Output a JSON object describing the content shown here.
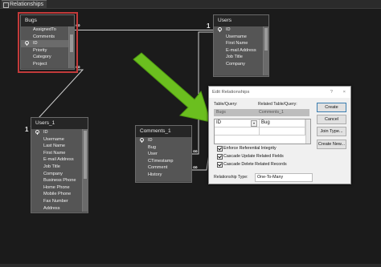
{
  "tab": {
    "title": "Relationships",
    "close": "×"
  },
  "tables": {
    "bugs": {
      "title": "Bugs",
      "rows": [
        "AssignedTo",
        "Comments",
        "ID",
        "Priority",
        "Category",
        "Project"
      ]
    },
    "users": {
      "title": "Users",
      "rows": [
        "ID",
        "Username",
        "First Name",
        "E-mail Address",
        "Job Title",
        "Company"
      ]
    },
    "users_1": {
      "title": "Users_1",
      "rows": [
        "ID",
        "Username",
        "Last Name",
        "First Name",
        "E-mail Address",
        "Job Title",
        "Company",
        "Business Phone",
        "Home Phone",
        "Mobile Phone",
        "Fax Number",
        "Address"
      ]
    },
    "comments_1": {
      "title": "Comments_1",
      "rows": [
        "ID",
        "Bug",
        "User",
        "CTimestamp",
        "Comment",
        "History"
      ]
    }
  },
  "marks": {
    "one": "1",
    "many": "∞"
  },
  "dialog": {
    "title": "Edit Relationships",
    "help": "?",
    "close": "×",
    "table_query_label": "Table/Query:",
    "related_label": "Related Table/Query:",
    "table": "Bugs",
    "related_table": "Comments_1",
    "field_left": "ID",
    "field_right": "Bug",
    "enforce": "Enforce Referential Integrity",
    "cascade_update": "Cascade Update Related Fields",
    "cascade_delete": "Cascade Delete Related Records",
    "relationship_type_label": "Relationship Type:",
    "relationship_type": "One-To-Many",
    "buttons": {
      "create": "Create",
      "cancel": "Cancel",
      "join_type": "Join Type...",
      "create_new": "Create New..."
    }
  },
  "colors": {
    "arrow": "#6bbf1f",
    "selection": "#c23a3a"
  }
}
